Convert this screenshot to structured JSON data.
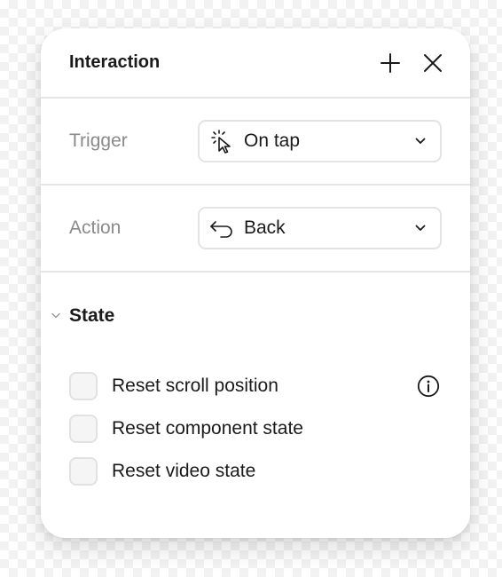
{
  "panel": {
    "title": "Interaction",
    "add_icon": "plus-icon",
    "close_icon": "close-icon"
  },
  "trigger": {
    "label": "Trigger",
    "value": "On tap",
    "icon": "tap-cursor-icon"
  },
  "action": {
    "label": "Action",
    "value": "Back",
    "icon": "back-arrow-icon"
  },
  "state_section": {
    "title": "State",
    "expanded": true,
    "options": [
      {
        "label": "Reset scroll position",
        "checked": false,
        "has_info": true
      },
      {
        "label": "Reset component state",
        "checked": false,
        "has_info": false
      },
      {
        "label": "Reset video state",
        "checked": false,
        "has_info": false
      }
    ]
  },
  "colors": {
    "text": "#1a1a1a",
    "muted": "#8a8a8a",
    "divider": "#e5e5e5",
    "checkbox_fill": "#f5f5f5"
  }
}
